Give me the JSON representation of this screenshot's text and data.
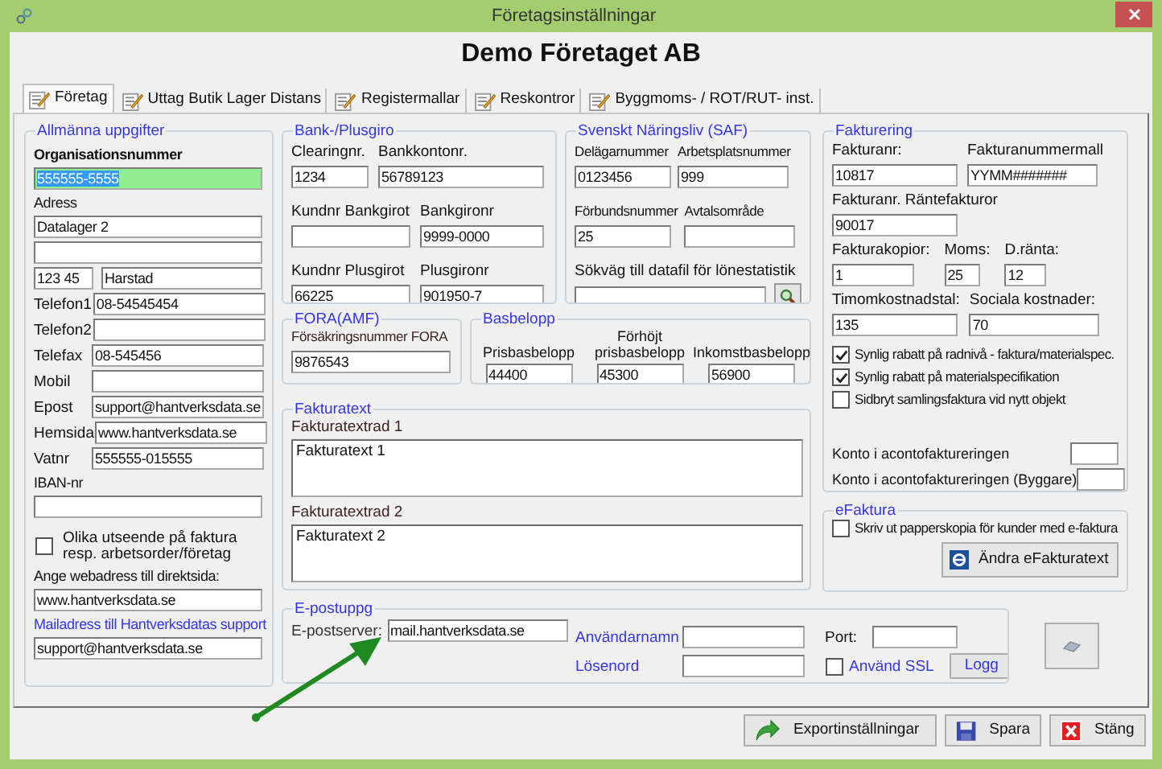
{
  "window": {
    "title": "Företagsinställningar"
  },
  "heading": "Demo Företaget AB",
  "tabs": [
    {
      "label": "Företag",
      "selected": true
    },
    {
      "label": "Uttag Butik Lager Distans",
      "selected": false
    },
    {
      "label": "Registermallar",
      "selected": false
    },
    {
      "label": "Reskontror",
      "selected": false
    },
    {
      "label": "Byggmoms- / ROT/RUT- inst.",
      "selected": false
    }
  ],
  "general": {
    "title": "Allmänna uppgifter",
    "rows": [
      {
        "kind": "stacked",
        "label": "Organisationsnummer",
        "bold": true,
        "value": "555555-5555",
        "highlighted": true
      },
      {
        "kind": "stacked",
        "label": "Adress",
        "value": "Datalager 2"
      },
      {
        "kind": "blank"
      },
      {
        "kind": "pair",
        "values": [
          "123 45",
          "Harstad"
        ]
      },
      {
        "kind": "inline",
        "label": "Telefon1",
        "value": "08-54545454"
      },
      {
        "kind": "inline",
        "label": "Telefon2"
      },
      {
        "kind": "inline",
        "label": "Telefax",
        "value": "08-545456"
      },
      {
        "kind": "inline",
        "label": "Mobil"
      },
      {
        "kind": "inline",
        "label": "Epost",
        "value": "support@hantverksdata.se"
      },
      {
        "kind": "inline",
        "label": "Hemsida",
        "value": "www.hantverksdata.se"
      },
      {
        "kind": "inline",
        "label": "Vatnr",
        "value": "555555-015555"
      },
      {
        "kind": "stacked",
        "label": "IBAN-nr"
      },
      {
        "kind": "checkbox",
        "label": "Olika utseende på faktura resp. arbetsorder/företag",
        "checked": false
      },
      {
        "kind": "stacked",
        "label": "Ange webadress till direktsida:",
        "value": "www.hantverksdata.se"
      },
      {
        "kind": "stacked",
        "label": "Mailadress till Hantverksdatas support",
        "link": true,
        "value": "support@hantverksdata.se"
      }
    ]
  },
  "bank": {
    "title": "Bank-/Plusgiro",
    "rows": [
      [
        {
          "label": "Clearingnr.",
          "value": "1234"
        },
        {
          "label": "Bankkontonr.",
          "value": "56789123"
        }
      ],
      [
        {
          "label": "Kundnr Bankgirot"
        },
        {
          "label": "Bankgironr",
          "value": "9999-0000"
        }
      ],
      [
        {
          "label": "Kundnr Plusgirot",
          "value": "66225"
        },
        {
          "label": "Plusgironr",
          "value": "901950-7"
        }
      ]
    ]
  },
  "saf": {
    "title": "Svenskt Näringsliv (SAF)",
    "rows": [
      [
        {
          "label": "Delägarnummer",
          "value": "0123456"
        },
        {
          "label": "Arbetsplatsnummer",
          "value": "999"
        }
      ],
      [
        {
          "label": "Förbundsnummer",
          "value": "25"
        },
        {
          "label": "Avtalsområde"
        }
      ]
    ],
    "path_label": "Sökväg till datafil för lönestatistik"
  },
  "fora": {
    "title": "FORA(AMF)",
    "label": "Försäkringsnummer FORA",
    "value": "9876543"
  },
  "basbelopp": {
    "title": "Basbelopp",
    "fields": [
      {
        "label": "Prisbasbelopp",
        "value": "44400"
      },
      {
        "label": "Förhöjt prisbasbelopp",
        "value": "45300"
      },
      {
        "label": "Inkomstbasbelopp",
        "value": "56900"
      }
    ]
  },
  "fakturatext": {
    "title": "Fakturatext",
    "fields": [
      {
        "label": "Fakturatextrad 1",
        "value": "Fakturatext 1"
      },
      {
        "label": "Fakturatextrad 2",
        "value": "Fakturatext 2"
      }
    ]
  },
  "fakturering": {
    "title": "Fakturering",
    "rows": [
      [
        {
          "label": "Fakturanr:",
          "value": "10817"
        },
        {
          "label": "Fakturanummermall",
          "value": "YYMM#######"
        }
      ],
      [
        {
          "label": "Fakturanr. Räntefakturor",
          "value": "90017"
        }
      ],
      [
        {
          "label": "Fakturakopior:",
          "value": "1"
        },
        {
          "label": "Moms:",
          "value": "25"
        },
        {
          "label": "D.ränta:",
          "value": "12"
        }
      ],
      [
        {
          "label": "Timomkostnadstal:",
          "value": "135"
        },
        {
          "label": "Sociala kostnader:",
          "value": "70"
        }
      ]
    ],
    "checks": [
      {
        "label": "Synlig rabatt på radnivå - faktura/materialspec.",
        "checked": true
      },
      {
        "label": "Synlig rabatt på materialspecifikation",
        "checked": true
      },
      {
        "label": "Sidbryt samlingsfaktura vid nytt objekt",
        "checked": false
      }
    ],
    "accounts": [
      {
        "label": "Konto i acontofaktureringen"
      },
      {
        "label": "Konto i acontofaktureringen (Byggare)"
      }
    ]
  },
  "efaktura": {
    "title": "eFaktura",
    "check": {
      "label": "Skriv ut papperskopia för kunder med e-faktura",
      "checked": false
    },
    "button": "Ändra eFakturatext"
  },
  "epost": {
    "title": "E-postuppg",
    "server_label": "E-postserver:",
    "server": "mail.hantverksdata.se",
    "user_label": "Användarnamn",
    "password_label": "Lösenord",
    "port_label": "Port:",
    "ssl": {
      "label": "Använd SSL",
      "checked": false
    },
    "log_button": "Logg"
  },
  "buttons": [
    {
      "kind": "export",
      "label": "Exportinställningar"
    },
    {
      "kind": "save",
      "label": "Spara"
    },
    {
      "kind": "close",
      "label": "Stäng"
    }
  ]
}
